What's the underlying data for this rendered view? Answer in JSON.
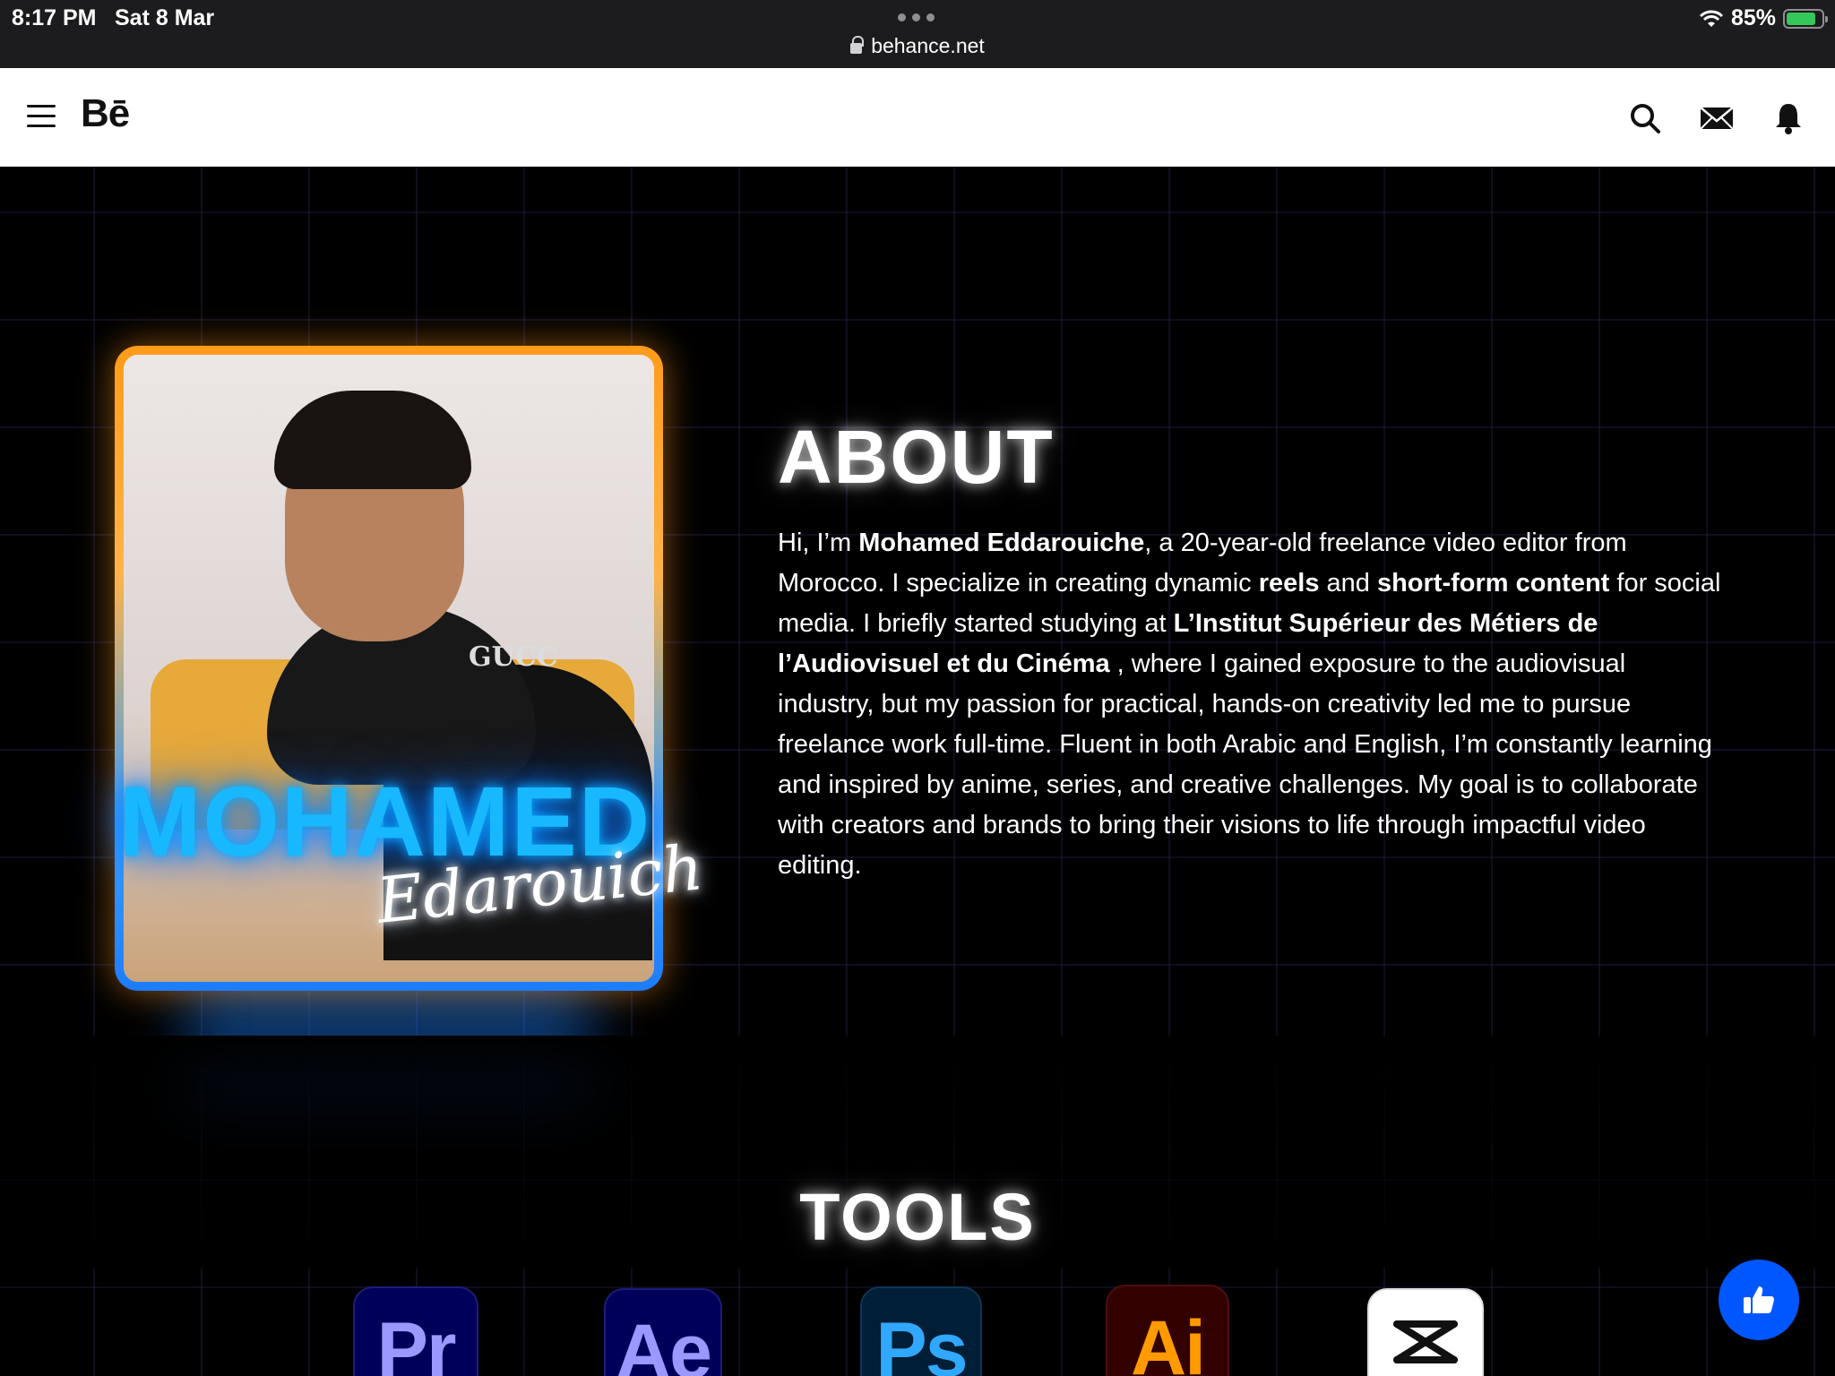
{
  "status_bar": {
    "time": "8:17 PM",
    "date": "Sat 8 Mar",
    "url": "behance.net",
    "battery": "85%",
    "battery_level": 0.85
  },
  "nav": {
    "logo": "Bē",
    "icons": [
      "menu-icon",
      "search-icon",
      "mail-icon",
      "bell-icon"
    ]
  },
  "hero": {
    "name": "MOHAMED",
    "script_name": "Edarouich",
    "photo_brand": "GUCC"
  },
  "about": {
    "title": "ABOUT",
    "p1": "Hi, I’m ",
    "b1": "Mohamed Eddarouiche",
    "p2": ", a 20-year-old freelance video editor from Morocco. I specialize in creating dynamic ",
    "b2": "reels",
    "p3": " and ",
    "b3": "short-form content",
    "p4": " for social media. I briefly started studying at ",
    "b4": "L’Institut Supérieur des Métiers de l’Audiovisuel et du Cinéma",
    "p5": " , where I gained exposure to the audiovisual industry, but my passion for practical, hands-on creativity led me to pursue freelance work full-time. Fluent in both Arabic and English, I’m constantly learning and inspired by anime, series, and creative challenges. My goal is to collaborate with creators and brands to bring their visions to life through impactful video editing."
  },
  "tools": {
    "title": "TOOLS",
    "items": [
      "Pr",
      "Ae",
      "Ps",
      "Ai"
    ]
  },
  "colors": {
    "accent_blue": "#18b8ff",
    "frame_orange": "#ff9c1a",
    "fab_blue": "#0057ff"
  }
}
